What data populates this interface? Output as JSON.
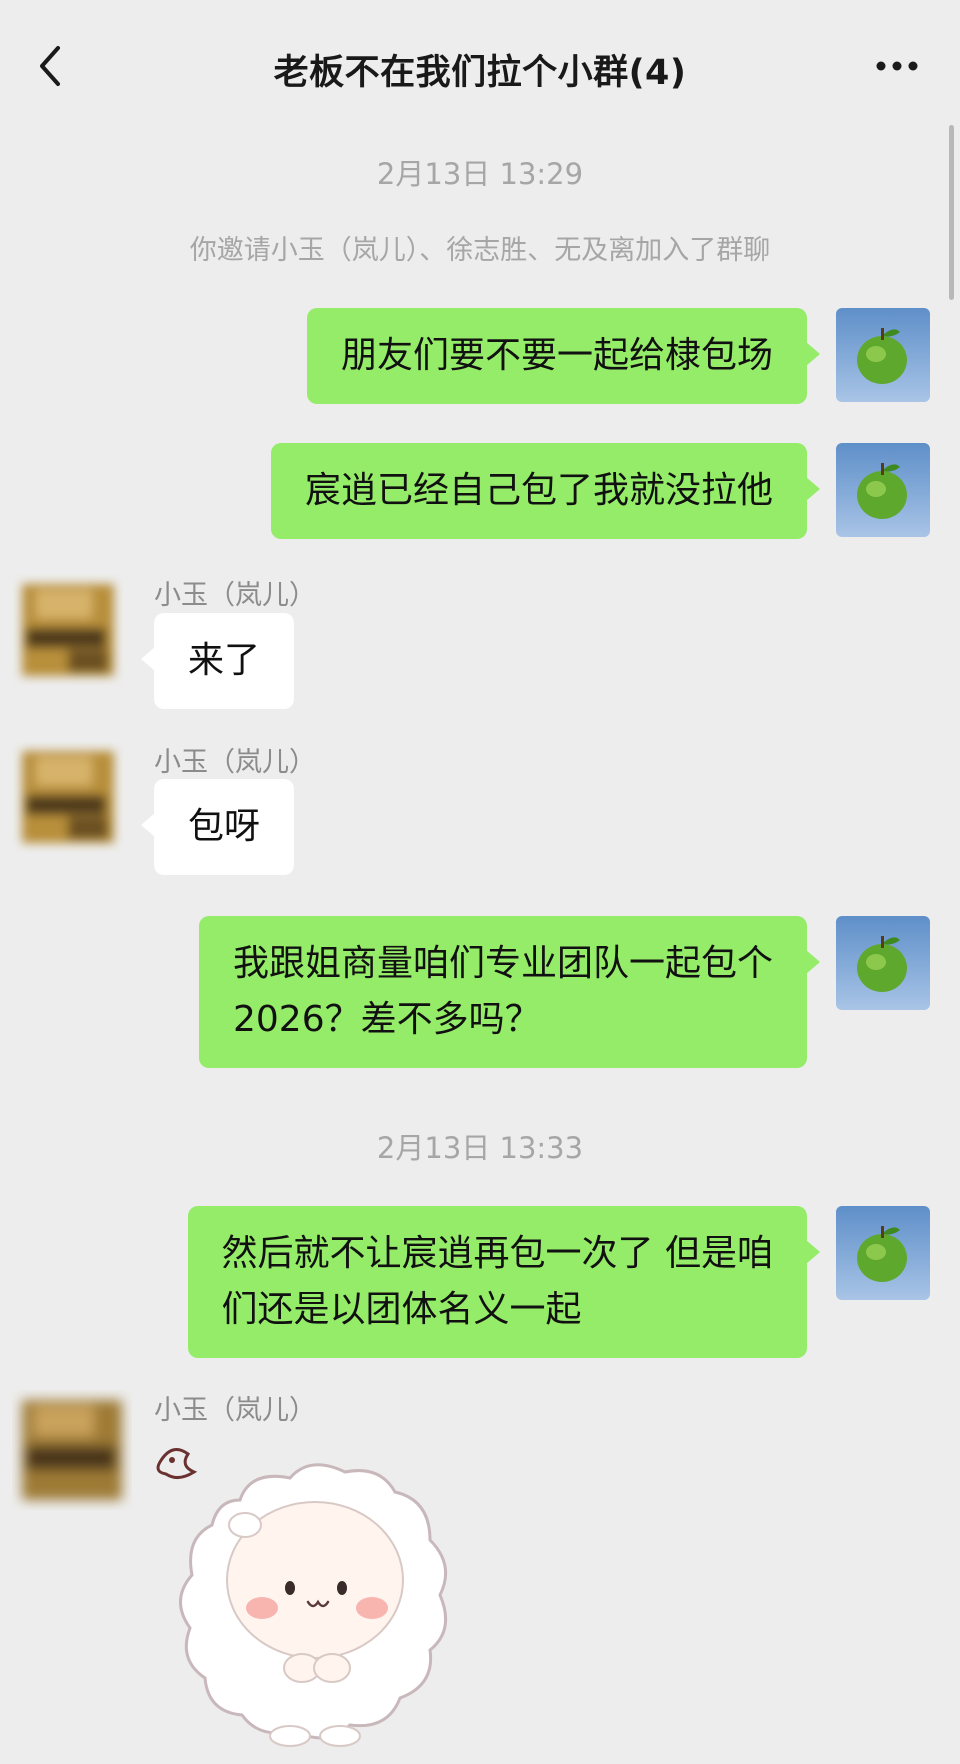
{
  "header": {
    "title": "老板不在我们拉个小群(4)"
  },
  "timestamps": [
    "2月13日 13:29",
    "2月13日 13:33"
  ],
  "system_message": "你邀请小玉（岚儿）、徐志胜、无及离加入了群聊",
  "messages": [
    {
      "from": "me",
      "text": "朋友们要不要一起给棣包场"
    },
    {
      "from": "me",
      "text": "宸逍已经自己包了我就没拉他"
    },
    {
      "from": "other",
      "sender": "小玉（岚儿）",
      "text": "来了"
    },
    {
      "from": "other",
      "sender": "小玉（岚儿）",
      "text": "包呀"
    },
    {
      "from": "me",
      "line1": "我跟姐商量咱们专业团队一起包个",
      "line2": "2026？差不多吗？"
    },
    {
      "from": "me",
      "line1": "然后就不让宸逍再包一次了 但是咱",
      "line2": "们还是以团体名义一起"
    },
    {
      "from": "other",
      "sender": "小玉（岚儿）",
      "type": "sticker",
      "sticker_icon": "cute-sheep-sticker-icon"
    }
  ],
  "colors": {
    "background": "#ededed",
    "my_bubble": "#95ec69",
    "other_bubble": "#ffffff",
    "meta_text": "#a6a6a6"
  },
  "icons": {
    "back": "chevron-left-icon",
    "more": "more-dots-icon",
    "my_avatar": "green-apple-avatar-icon"
  }
}
